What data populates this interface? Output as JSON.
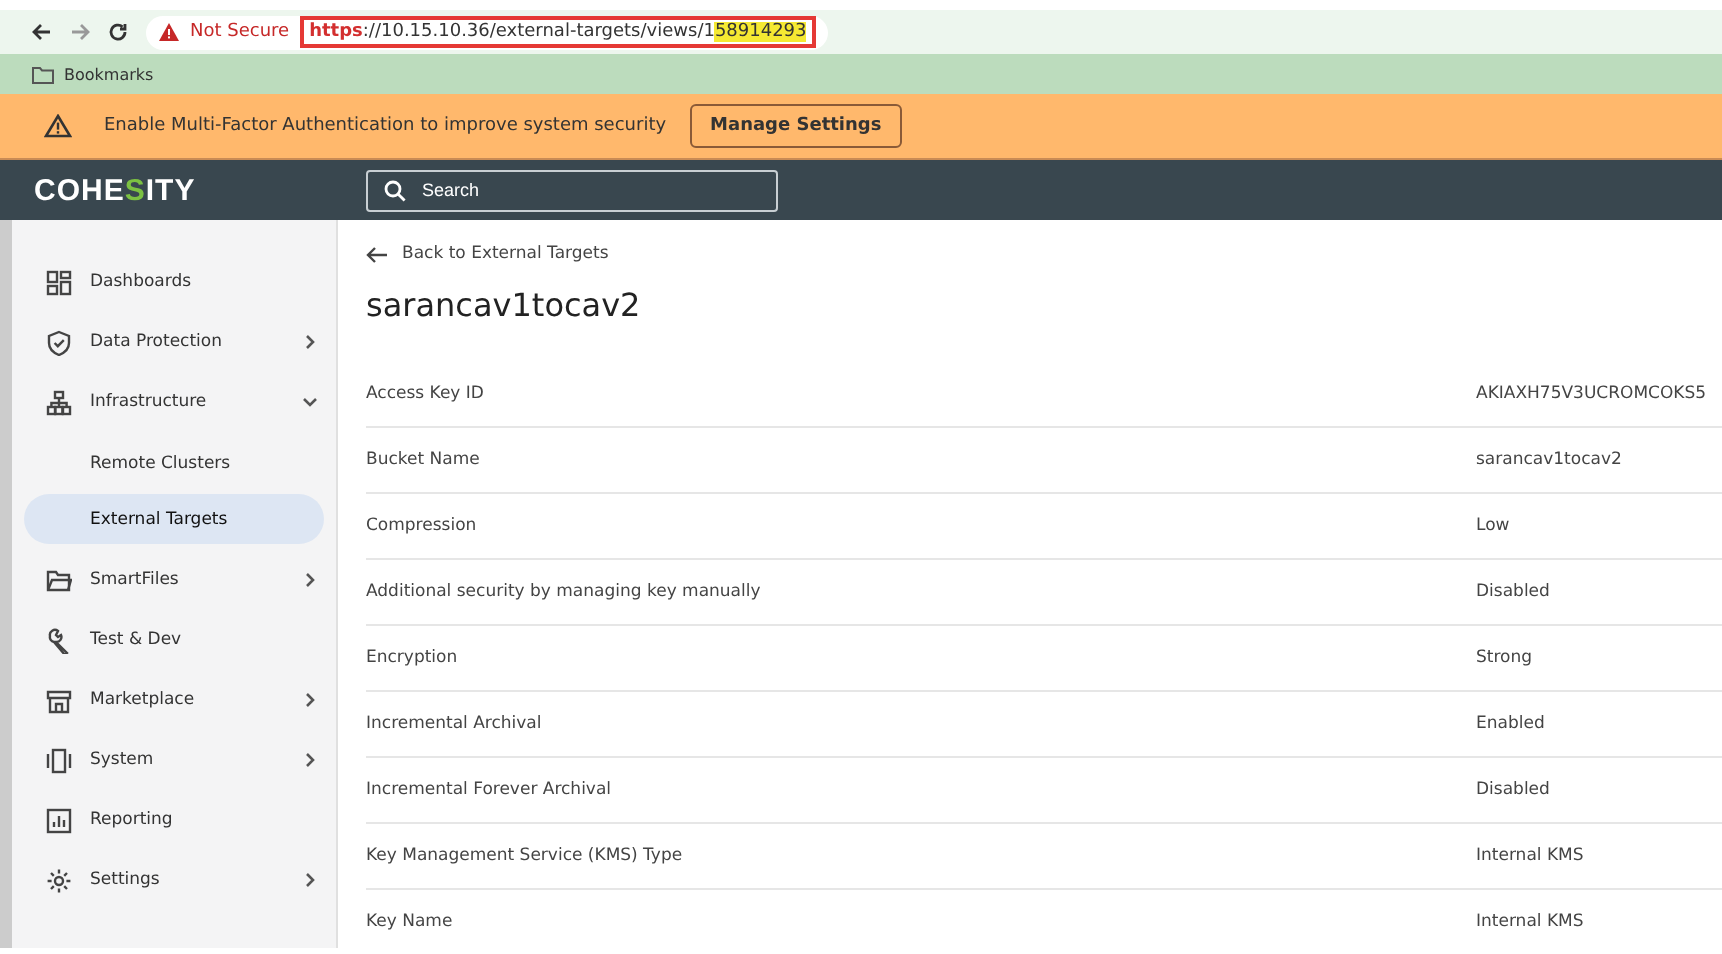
{
  "browser": {
    "security": "Not Secure",
    "url_scheme": "https",
    "url_rest": "://10.15.10.36/external-targets/views/1",
    "url_highlight": "58914293",
    "bookmarks": "Bookmarks"
  },
  "banner": {
    "message": "Enable Multi-Factor Authentication to improve system security",
    "button": "Manage Settings"
  },
  "header": {
    "logo_before": "COHE",
    "logo_accent": "S",
    "logo_after": "ITY",
    "search": {
      "placeholder": "Search"
    }
  },
  "sidebar": {
    "items": [
      {
        "label": "Dashboards"
      },
      {
        "label": "Data Protection",
        "expanded": false
      },
      {
        "label": "Infrastructure",
        "expanded": true,
        "children": [
          {
            "label": "Remote Clusters",
            "selected": false
          },
          {
            "label": "External Targets",
            "selected": true
          }
        ]
      },
      {
        "label": "SmartFiles",
        "expanded": false
      },
      {
        "label": "Test & Dev"
      },
      {
        "label": "Marketplace",
        "expanded": false
      },
      {
        "label": "System",
        "expanded": false
      },
      {
        "label": "Reporting"
      },
      {
        "label": "Settings",
        "expanded": false
      }
    ]
  },
  "main": {
    "back_link": "Back to External Targets",
    "title": "sarancav1tocav2",
    "details": [
      {
        "label": "Access Key ID",
        "value": "AKIAXH75V3UCROMCOKS5"
      },
      {
        "label": "Bucket Name",
        "value": "sarancav1tocav2"
      },
      {
        "label": "Compression",
        "value": "Low"
      },
      {
        "label": "Additional security by managing key manually",
        "value": "Disabled"
      },
      {
        "label": "Encryption",
        "value": "Strong"
      },
      {
        "label": "Incremental Archival",
        "value": "Enabled"
      },
      {
        "label": "Incremental Forever Archival",
        "value": "Disabled"
      },
      {
        "label": "Key Management Service (KMS) Type",
        "value": "Internal KMS"
      },
      {
        "label": "Key Name",
        "value": "Internal KMS"
      }
    ]
  }
}
